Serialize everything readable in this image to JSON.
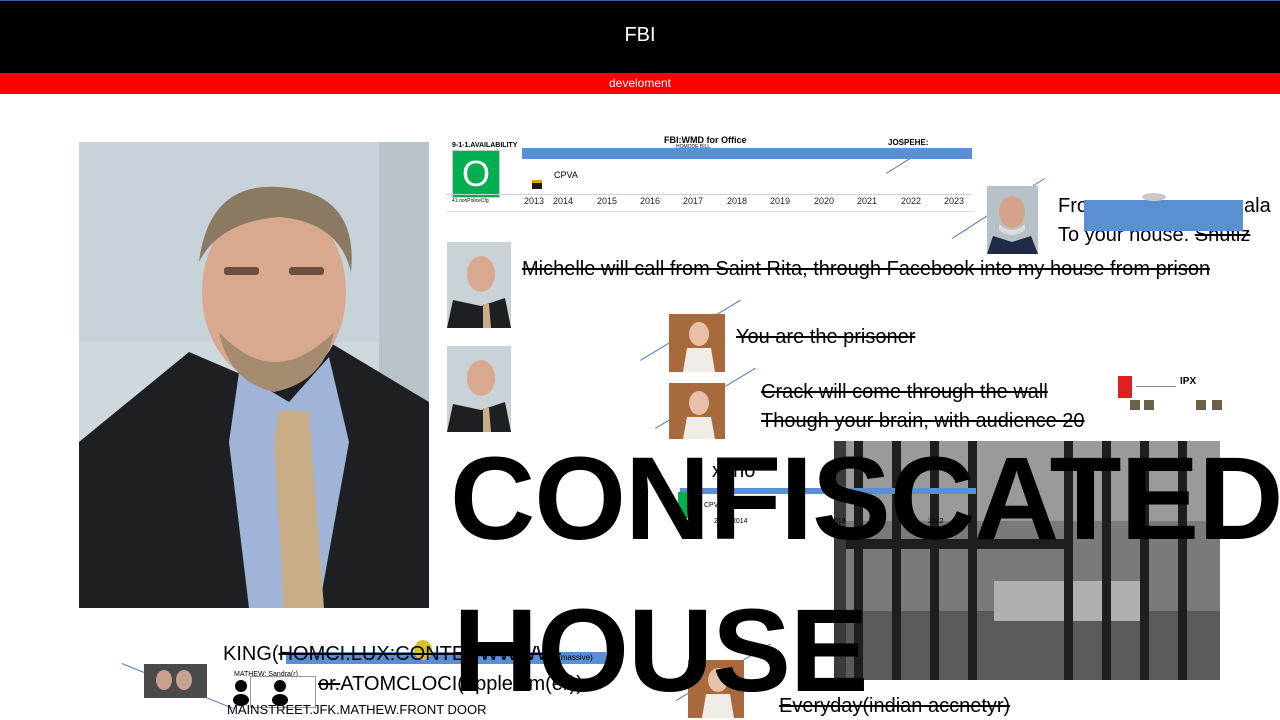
{
  "header": {
    "title": "FBI",
    "subtitle": "develoment"
  },
  "timeline": {
    "availability_label": "9-1-1.AVAILABILITY",
    "availability_letter": "O",
    "availability_sub": "41.nonPoliceCfg",
    "heading": "FBI:WMD for Office",
    "heading_sub": "HOMODE BILL",
    "cpva": "CPVA",
    "jospehe": "JOSPEHE:",
    "years": [
      "2013",
      "2014",
      "2015",
      "2016",
      "2017",
      "2018",
      "2019",
      "2020",
      "2021",
      "2022",
      "2023"
    ]
  },
  "texts": {
    "from_line1": "Fro",
    "from_line1_end": "ala",
    "from_line2": "To your house.",
    "from_line2_strike": "Shutlz",
    "michelle": "Michelle will call from Saint Rita, through Facebook into my house from prison",
    "prisoner": "You are the prisoner",
    "crack1": "Crack will come through the wall",
    "crack2": "Though your brain, with audience 20",
    "partial": "x] no",
    "ipx": "IPX",
    "king_prefix": "KING(",
    "king_strike": "HOMCI.LUX:CONTENWWWWI",
    "king_suffix": "massive)",
    "atom_strike": "or.",
    "atom_rest": "ATOMCLOCI(apple.tim(er))",
    "mathew": "MATHEW: Sandra(r)",
    "mainstreet": "MAINSTREET.JFK.MATHEW.FRONT  DOOR",
    "everyday": "Everyday(indian accnetyr)",
    "confiscated": "CONFISCATED",
    "house": "HOUSE"
  },
  "colors": {
    "header_bg": "#000000",
    "red_bar": "#ff0000",
    "accent_blue": "#4b78c8",
    "green": "#00b050"
  },
  "icons": [
    "portrait-photo",
    "cell-bars-image",
    "avatar-thumbnail"
  ]
}
